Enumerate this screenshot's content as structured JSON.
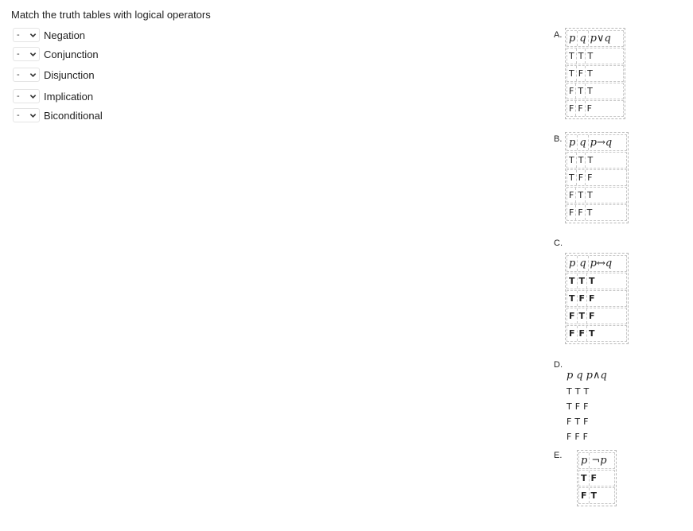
{
  "prompt": "Match the truth tables with logical operators",
  "rows": [
    {
      "value": "-",
      "label": "Negation"
    },
    {
      "value": "-",
      "label": "Conjunction"
    },
    {
      "value": "-",
      "label": "Disjunction"
    },
    {
      "value": "-",
      "label": "Implication"
    },
    {
      "value": "-",
      "label": "Biconditional"
    }
  ],
  "tables": {
    "A": {
      "letter": "A.",
      "header": [
        "p",
        "q",
        "p∨q"
      ],
      "rows": [
        [
          "T",
          "T",
          "T"
        ],
        [
          "T",
          "F",
          "T"
        ],
        [
          "F",
          "T",
          "T"
        ],
        [
          "F",
          "F",
          "F"
        ]
      ]
    },
    "B": {
      "letter": "B.",
      "header": [
        "p",
        "q",
        "p→q"
      ],
      "rows": [
        [
          "T",
          "T",
          "T"
        ],
        [
          "T",
          "F",
          "F"
        ],
        [
          "F",
          "T",
          "T"
        ],
        [
          "F",
          "F",
          "T"
        ]
      ]
    },
    "C": {
      "letter": "C.",
      "header": [
        "p",
        "q",
        "p↔q"
      ],
      "rows": [
        [
          "T",
          "T",
          "T"
        ],
        [
          "T",
          "F",
          "F"
        ],
        [
          "F",
          "T",
          "F"
        ],
        [
          "F",
          "F",
          "T"
        ]
      ]
    },
    "D": {
      "letter": "D.",
      "header": [
        "p",
        "q",
        "p∧q"
      ],
      "rows": [
        [
          "T",
          "T",
          "T"
        ],
        [
          "T",
          "F",
          "F"
        ],
        [
          "F",
          "T",
          "F"
        ],
        [
          "F",
          "F",
          "F"
        ]
      ]
    },
    "E": {
      "letter": "E.",
      "header": [
        "p",
        "¬p"
      ],
      "rows": [
        [
          "T",
          "F"
        ],
        [
          "F",
          "T"
        ]
      ]
    }
  }
}
